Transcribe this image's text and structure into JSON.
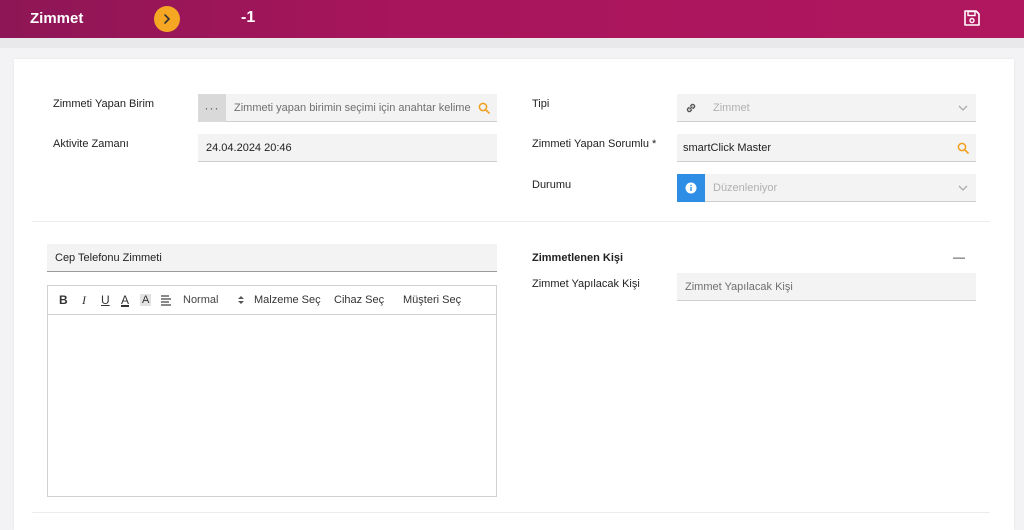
{
  "header": {
    "title": "Zimmet",
    "record_number": "-1",
    "toggle_icon": "chevron-right-icon",
    "save_icon": "save-icon",
    "accent": "#f5a623",
    "brand": "#a8155c"
  },
  "form": {
    "unit": {
      "label": "Zimmeti Yapan Birim",
      "placeholder": "Zimmeti yapan birimin seçimi için anahtar kelime",
      "dots": "···"
    },
    "activity_time": {
      "label": "Aktivite Zamanı",
      "value": "24.04.2024 20:46"
    },
    "type": {
      "label": "Tipi",
      "value": "Zimmet"
    },
    "responsible": {
      "label": "Zimmeti Yapan Sorumlu",
      "required_mark": "*",
      "value": "smartClick Master"
    },
    "status": {
      "label": "Durumu",
      "value": "Düzenleniyor"
    }
  },
  "subject": {
    "value": "Cep Telefonu Zimmeti"
  },
  "editor": {
    "bold": "B",
    "italic": "I",
    "underline": "U",
    "font_color": "A",
    "bg_color": "A",
    "format_select": "Normal",
    "material_button": "Malzeme Seç",
    "device_button": "Cihaz Seç",
    "customer_button": "Müşteri Seç"
  },
  "person_section": {
    "title": "Zimmetlenen Kişi",
    "collapse": "—",
    "person": {
      "label": "Zimmet Yapılacak Kişi",
      "placeholder": "Zimmet Yapılacak Kişi"
    }
  }
}
